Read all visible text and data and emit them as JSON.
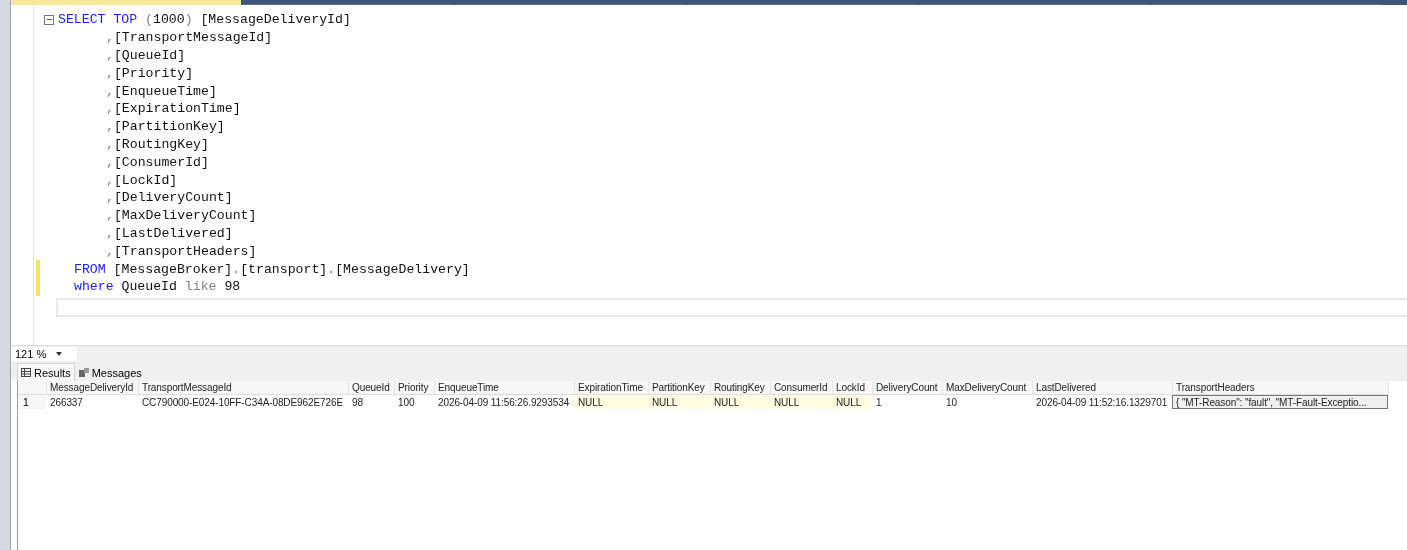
{
  "document_tabs": [
    {
      "selected": true
    },
    {
      "selected": false
    },
    {
      "selected": false
    },
    {
      "selected": false
    },
    {
      "selected": false
    },
    {
      "selected": false
    }
  ],
  "editor": {
    "lines": [
      {
        "kind": "statement",
        "changed": false,
        "collapsible": true,
        "segments": [
          {
            "kind": "keyword",
            "text": "SELECT"
          },
          {
            "kind": "keyword",
            "text": " TOP"
          },
          {
            "kind": "operator",
            "text": " ("
          },
          {
            "kind": "plain",
            "text": "1000"
          },
          {
            "kind": "operator",
            "text": ")"
          },
          {
            "kind": "plain",
            "text": " [MessageDeliveryId]"
          }
        ]
      },
      {
        "kind": "column",
        "changed": false,
        "collapsible": false,
        "segments": [
          {
            "kind": "operator",
            "text": ","
          },
          {
            "kind": "plain",
            "text": "[TransportMessageId]"
          }
        ]
      },
      {
        "kind": "column",
        "changed": false,
        "collapsible": false,
        "segments": [
          {
            "kind": "operator",
            "text": ","
          },
          {
            "kind": "plain",
            "text": "[QueueId]"
          }
        ]
      },
      {
        "kind": "column",
        "changed": false,
        "collapsible": false,
        "segments": [
          {
            "kind": "operator",
            "text": ","
          },
          {
            "kind": "plain",
            "text": "[Priority]"
          }
        ]
      },
      {
        "kind": "column",
        "changed": false,
        "collapsible": false,
        "segments": [
          {
            "kind": "operator",
            "text": ","
          },
          {
            "kind": "plain",
            "text": "[EnqueueTime]"
          }
        ]
      },
      {
        "kind": "column",
        "changed": false,
        "collapsible": false,
        "segments": [
          {
            "kind": "operator",
            "text": ","
          },
          {
            "kind": "plain",
            "text": "[ExpirationTime]"
          }
        ]
      },
      {
        "kind": "column",
        "changed": false,
        "collapsible": false,
        "segments": [
          {
            "kind": "operator",
            "text": ","
          },
          {
            "kind": "plain",
            "text": "[PartitionKey]"
          }
        ]
      },
      {
        "kind": "column",
        "changed": false,
        "collapsible": false,
        "segments": [
          {
            "kind": "operator",
            "text": ","
          },
          {
            "kind": "plain",
            "text": "[RoutingKey]"
          }
        ]
      },
      {
        "kind": "column",
        "changed": false,
        "collapsible": false,
        "segments": [
          {
            "kind": "operator",
            "text": ","
          },
          {
            "kind": "plain",
            "text": "[ConsumerId]"
          }
        ]
      },
      {
        "kind": "column",
        "changed": false,
        "collapsible": false,
        "segments": [
          {
            "kind": "operator",
            "text": ","
          },
          {
            "kind": "plain",
            "text": "[LockId]"
          }
        ]
      },
      {
        "kind": "column",
        "changed": false,
        "collapsible": false,
        "segments": [
          {
            "kind": "operator",
            "text": ","
          },
          {
            "kind": "plain",
            "text": "[DeliveryCount]"
          }
        ]
      },
      {
        "kind": "column",
        "changed": false,
        "collapsible": false,
        "segments": [
          {
            "kind": "operator",
            "text": ","
          },
          {
            "kind": "plain",
            "text": "[MaxDeliveryCount]"
          }
        ]
      },
      {
        "kind": "column",
        "changed": false,
        "collapsible": false,
        "segments": [
          {
            "kind": "operator",
            "text": ","
          },
          {
            "kind": "plain",
            "text": "[LastDelivered]"
          }
        ]
      },
      {
        "kind": "column",
        "changed": false,
        "collapsible": false,
        "segments": [
          {
            "kind": "operator",
            "text": ","
          },
          {
            "kind": "plain",
            "text": "[TransportHeaders]"
          }
        ]
      },
      {
        "kind": "clause",
        "changed": true,
        "collapsible": false,
        "segments": [
          {
            "kind": "keyword",
            "text": "FROM"
          },
          {
            "kind": "plain",
            "text": " [MessageBroker]"
          },
          {
            "kind": "operator",
            "text": "."
          },
          {
            "kind": "plain",
            "text": "[transport]"
          },
          {
            "kind": "operator",
            "text": "."
          },
          {
            "kind": "plain",
            "text": "[MessageDelivery]"
          }
        ]
      },
      {
        "kind": "clause",
        "changed": true,
        "collapsible": false,
        "segments": [
          {
            "kind": "keyword",
            "text": "where"
          },
          {
            "kind": "plain",
            "text": " QueueId"
          },
          {
            "kind": "operator",
            "text": " like"
          },
          {
            "kind": "plain",
            "text": " 98"
          }
        ]
      }
    ]
  },
  "zoom": "121 %",
  "result_tabs": [
    {
      "label": "Results",
      "selected": true
    },
    {
      "label": "Messages",
      "selected": false
    }
  ],
  "grid": {
    "columns": [
      "MessageDeliveryId",
      "TransportMessageId",
      "QueueId",
      "Priority",
      "EnqueueTime",
      "ExpirationTime",
      "PartitionKey",
      "RoutingKey",
      "ConsumerId",
      "LockId",
      "DeliveryCount",
      "MaxDeliveryCount",
      "LastDelivered",
      "TransportHeaders"
    ],
    "rows": [
      {
        "number": "1",
        "cells": [
          {
            "text": "266337",
            "null": false,
            "selected": false
          },
          {
            "text": "CC790000-E024-10FF-C34A-08DE962E726E",
            "null": false,
            "selected": false
          },
          {
            "text": "98",
            "null": false,
            "selected": false
          },
          {
            "text": "100",
            "null": false,
            "selected": false
          },
          {
            "text": "2026-04-09 11:56:26.9293534",
            "null": false,
            "selected": false
          },
          {
            "text": "NULL",
            "null": true,
            "selected": false
          },
          {
            "text": "NULL",
            "null": true,
            "selected": false
          },
          {
            "text": "NULL",
            "null": true,
            "selected": false
          },
          {
            "text": "NULL",
            "null": true,
            "selected": false
          },
          {
            "text": "NULL",
            "null": true,
            "selected": false
          },
          {
            "text": "1",
            "null": false,
            "selected": false
          },
          {
            "text": "10",
            "null": false,
            "selected": false
          },
          {
            "text": "2026-04-09 11:52:16.1329701",
            "null": false,
            "selected": false
          },
          {
            "text": "{   \"MT-Reason\": \"fault\",    \"MT-Fault-Exceptio...",
            "null": false,
            "selected": true
          }
        ]
      }
    ]
  }
}
